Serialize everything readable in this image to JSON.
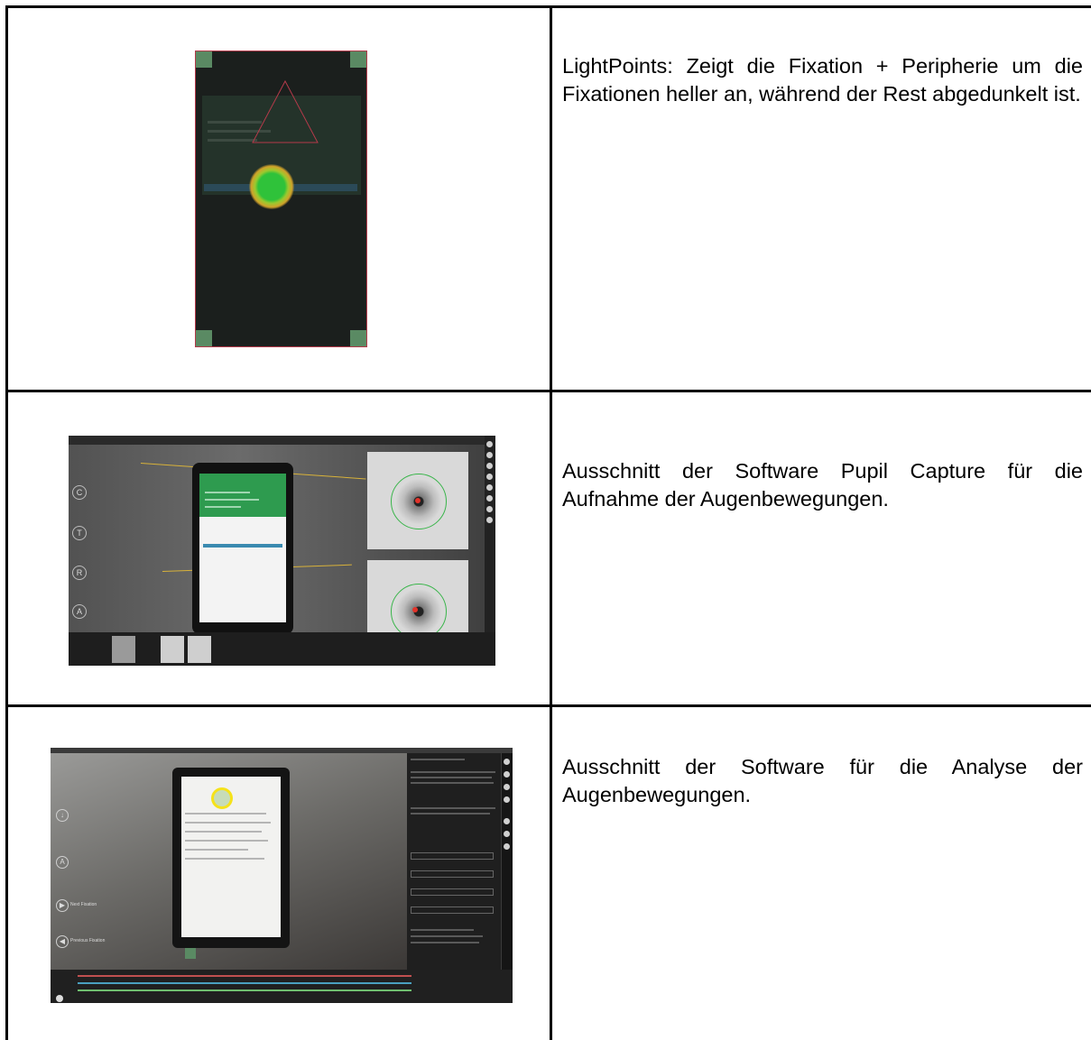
{
  "rows": [
    {
      "description": "LightPoints: Zeigt die Fixation + Peripherie um die Fixationen heller an, während der Rest abgedunkelt ist.",
      "image_icon": "tablet-fixation-screenshot-icon"
    },
    {
      "description": "Ausschnitt der Software Pupil Capture für die Aufnahme der Augenbewegungen.",
      "image_icon": "pupil-capture-screenshot-icon",
      "side_buttons": [
        "C",
        "T",
        "R",
        "A"
      ]
    },
    {
      "description": "Ausschnitt der Software für die Analyse der Augenbewegungen.",
      "image_icon": "pupil-player-screenshot-icon",
      "side_buttons": [
        "A"
      ],
      "nav_labels": [
        "Next Fixation",
        "Previous Fixation"
      ]
    }
  ],
  "colors": {
    "border": "#000000",
    "accent_green": "#2e9b4f",
    "fixation_yellow": "#f5e21a"
  }
}
